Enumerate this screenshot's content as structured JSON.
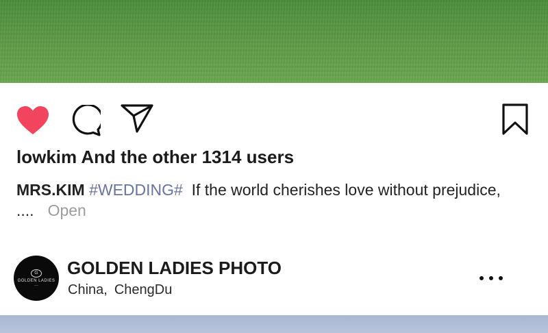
{
  "post": {
    "likes_text": "lowkim And the other 1314 users",
    "caption_author": "MRS.KIM",
    "caption_tag": "#WEDDING#",
    "caption_text": "If the world cherishes love without prejudice, ....",
    "caption_more": "Open"
  },
  "actions": {
    "like_icon": "heart-icon",
    "like_color": "#f2445d",
    "comment_icon": "comment-bubble-icon",
    "share_icon": "paper-plane-icon",
    "save_icon": "bookmark-icon"
  },
  "next_post": {
    "avatar_text": "GOLDEN LADIES",
    "account_name": "GOLDEN LADIES PHOTO",
    "location_country": "China,",
    "location_city": "ChengDu",
    "options_icon": "more-dots-icon"
  }
}
